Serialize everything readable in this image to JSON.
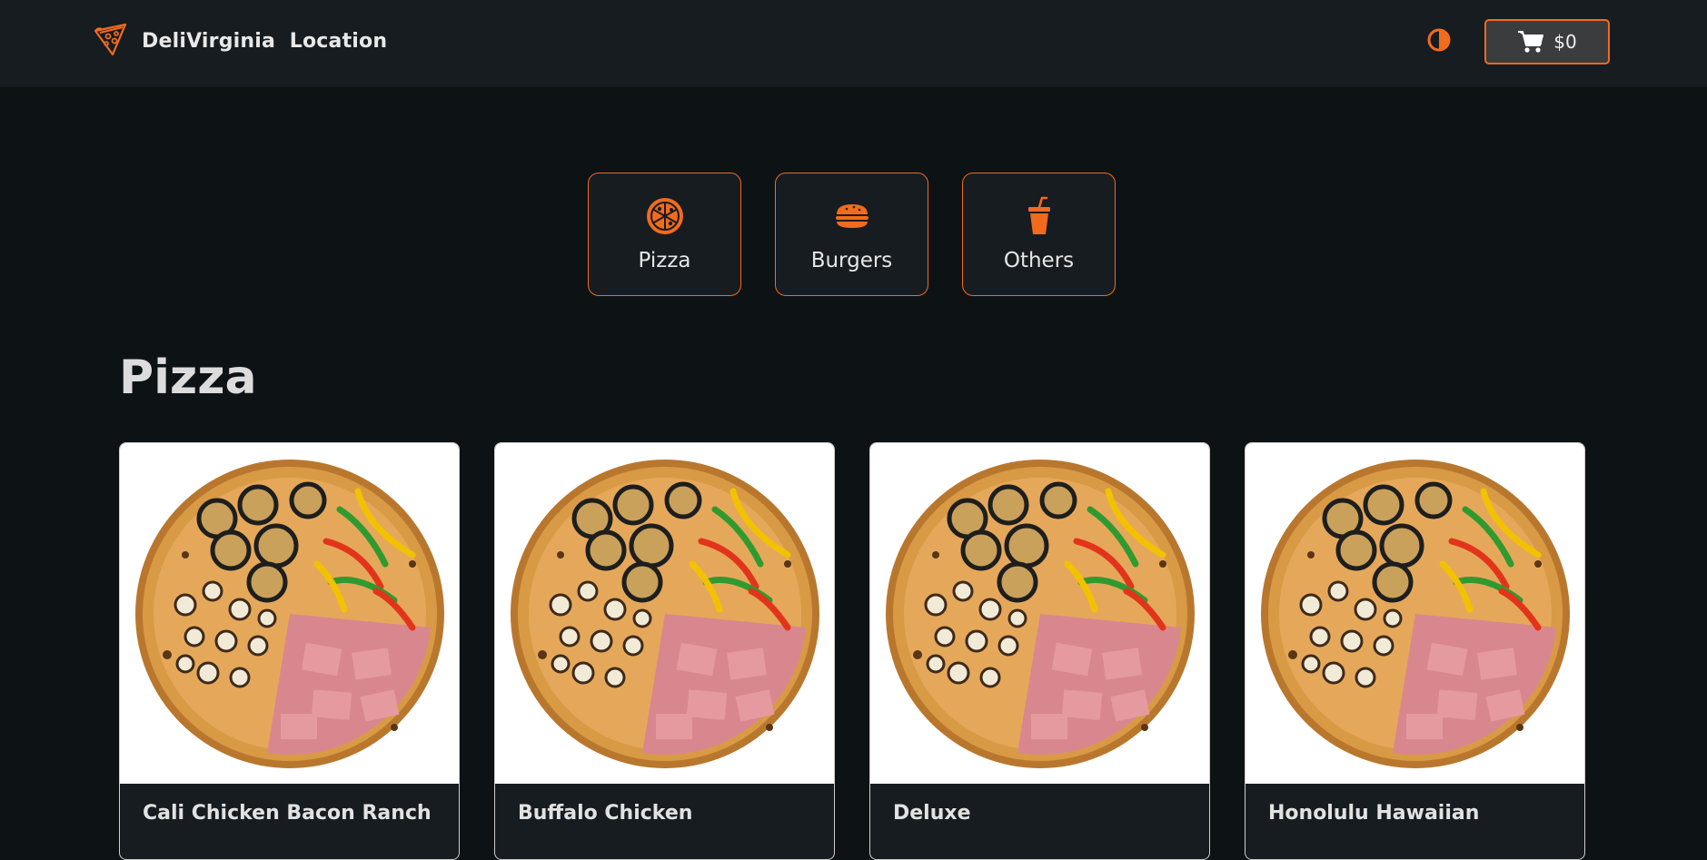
{
  "header": {
    "brand_name": "DeliVirginia  Location",
    "logo_icon": "pizza-slice-logo-icon",
    "theme_icon": "contrast-half-circle-icon",
    "cart_icon": "shopping-cart-icon",
    "cart_total": "$0"
  },
  "categories": [
    {
      "label": "Pizza",
      "icon": "pizza-icon"
    },
    {
      "label": "Burgers",
      "icon": "burger-icon"
    },
    {
      "label": "Others",
      "icon": "drink-cup-icon"
    }
  ],
  "section": {
    "title": "Pizza"
  },
  "products": [
    {
      "name": "Cali Chicken Bacon Ranch",
      "image": "pizza-image"
    },
    {
      "name": "Buffalo Chicken",
      "image": "pizza-image"
    },
    {
      "name": "Deluxe",
      "image": "pizza-image"
    },
    {
      "name": "Honolulu Hawaiian",
      "image": "pizza-image"
    }
  ],
  "colors": {
    "accent": "#f26b1d",
    "background": "#0d1215",
    "surface": "#161c20",
    "card_image_bg": "#ffffff"
  }
}
